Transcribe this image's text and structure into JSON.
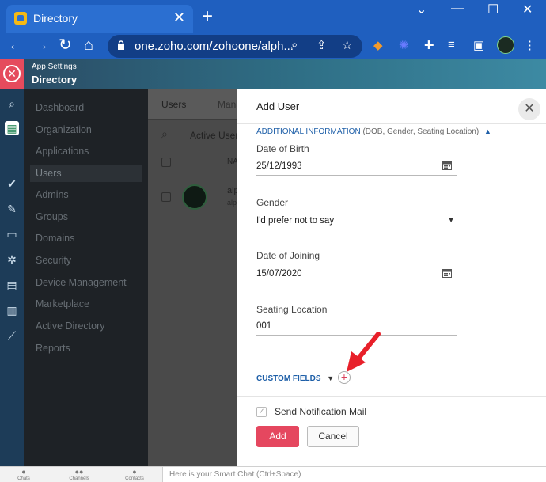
{
  "browser": {
    "tab_title": "Directory",
    "tab_close": "✕",
    "new_tab": "+",
    "url": "one.zoho.com/zohoone/alph...",
    "window_controls": [
      "⌄",
      "—",
      "☐",
      "✕"
    ]
  },
  "app_header": {
    "subtitle": "App Settings",
    "title": "Directory"
  },
  "sidebar": {
    "items": [
      {
        "label": "Dashboard"
      },
      {
        "label": "Organization"
      },
      {
        "label": "Applications"
      },
      {
        "label": "Users",
        "selected": true
      },
      {
        "label": "Admins"
      },
      {
        "label": "Groups"
      },
      {
        "label": "Domains"
      },
      {
        "label": "Security"
      },
      {
        "label": "Device Management"
      },
      {
        "label": "Marketplace"
      },
      {
        "label": "Active Directory"
      },
      {
        "label": "Reports"
      }
    ]
  },
  "main": {
    "tab_users": "Users",
    "tab_manage": "Mana",
    "filter_label": "Active Users",
    "col_name": "NA",
    "row_name": "alp",
    "row_sub": "alp"
  },
  "panel": {
    "title": "Add User",
    "section_title": "ADDITIONAL INFORMATION",
    "section_hint": "(DOB, Gender, Seating Location)",
    "fields": {
      "dob_label": "Date of Birth",
      "dob_value": "25/12/1993",
      "gender_label": "Gender",
      "gender_value": "I'd prefer not to say",
      "doj_label": "Date of Joining",
      "doj_value": "15/07/2020",
      "seating_label": "Seating Location",
      "seating_value": "001"
    },
    "custom_fields": "CUSTOM FIELDS",
    "add_field": "+",
    "notify_label": "Send Notification Mail",
    "notify_checked": true,
    "add_button": "Add",
    "cancel_button": "Cancel"
  },
  "bottom_bar": {
    "items": [
      "Chats",
      "Channels",
      "Contacts"
    ],
    "smart_chat_placeholder": "Here is your Smart Chat (Ctrl+Space)"
  },
  "colors": {
    "browser_blue": "#1f5fbf",
    "accent_red": "#e5475f",
    "link_blue": "#1e5fa8",
    "annotation_arrow": "#e8202a"
  }
}
